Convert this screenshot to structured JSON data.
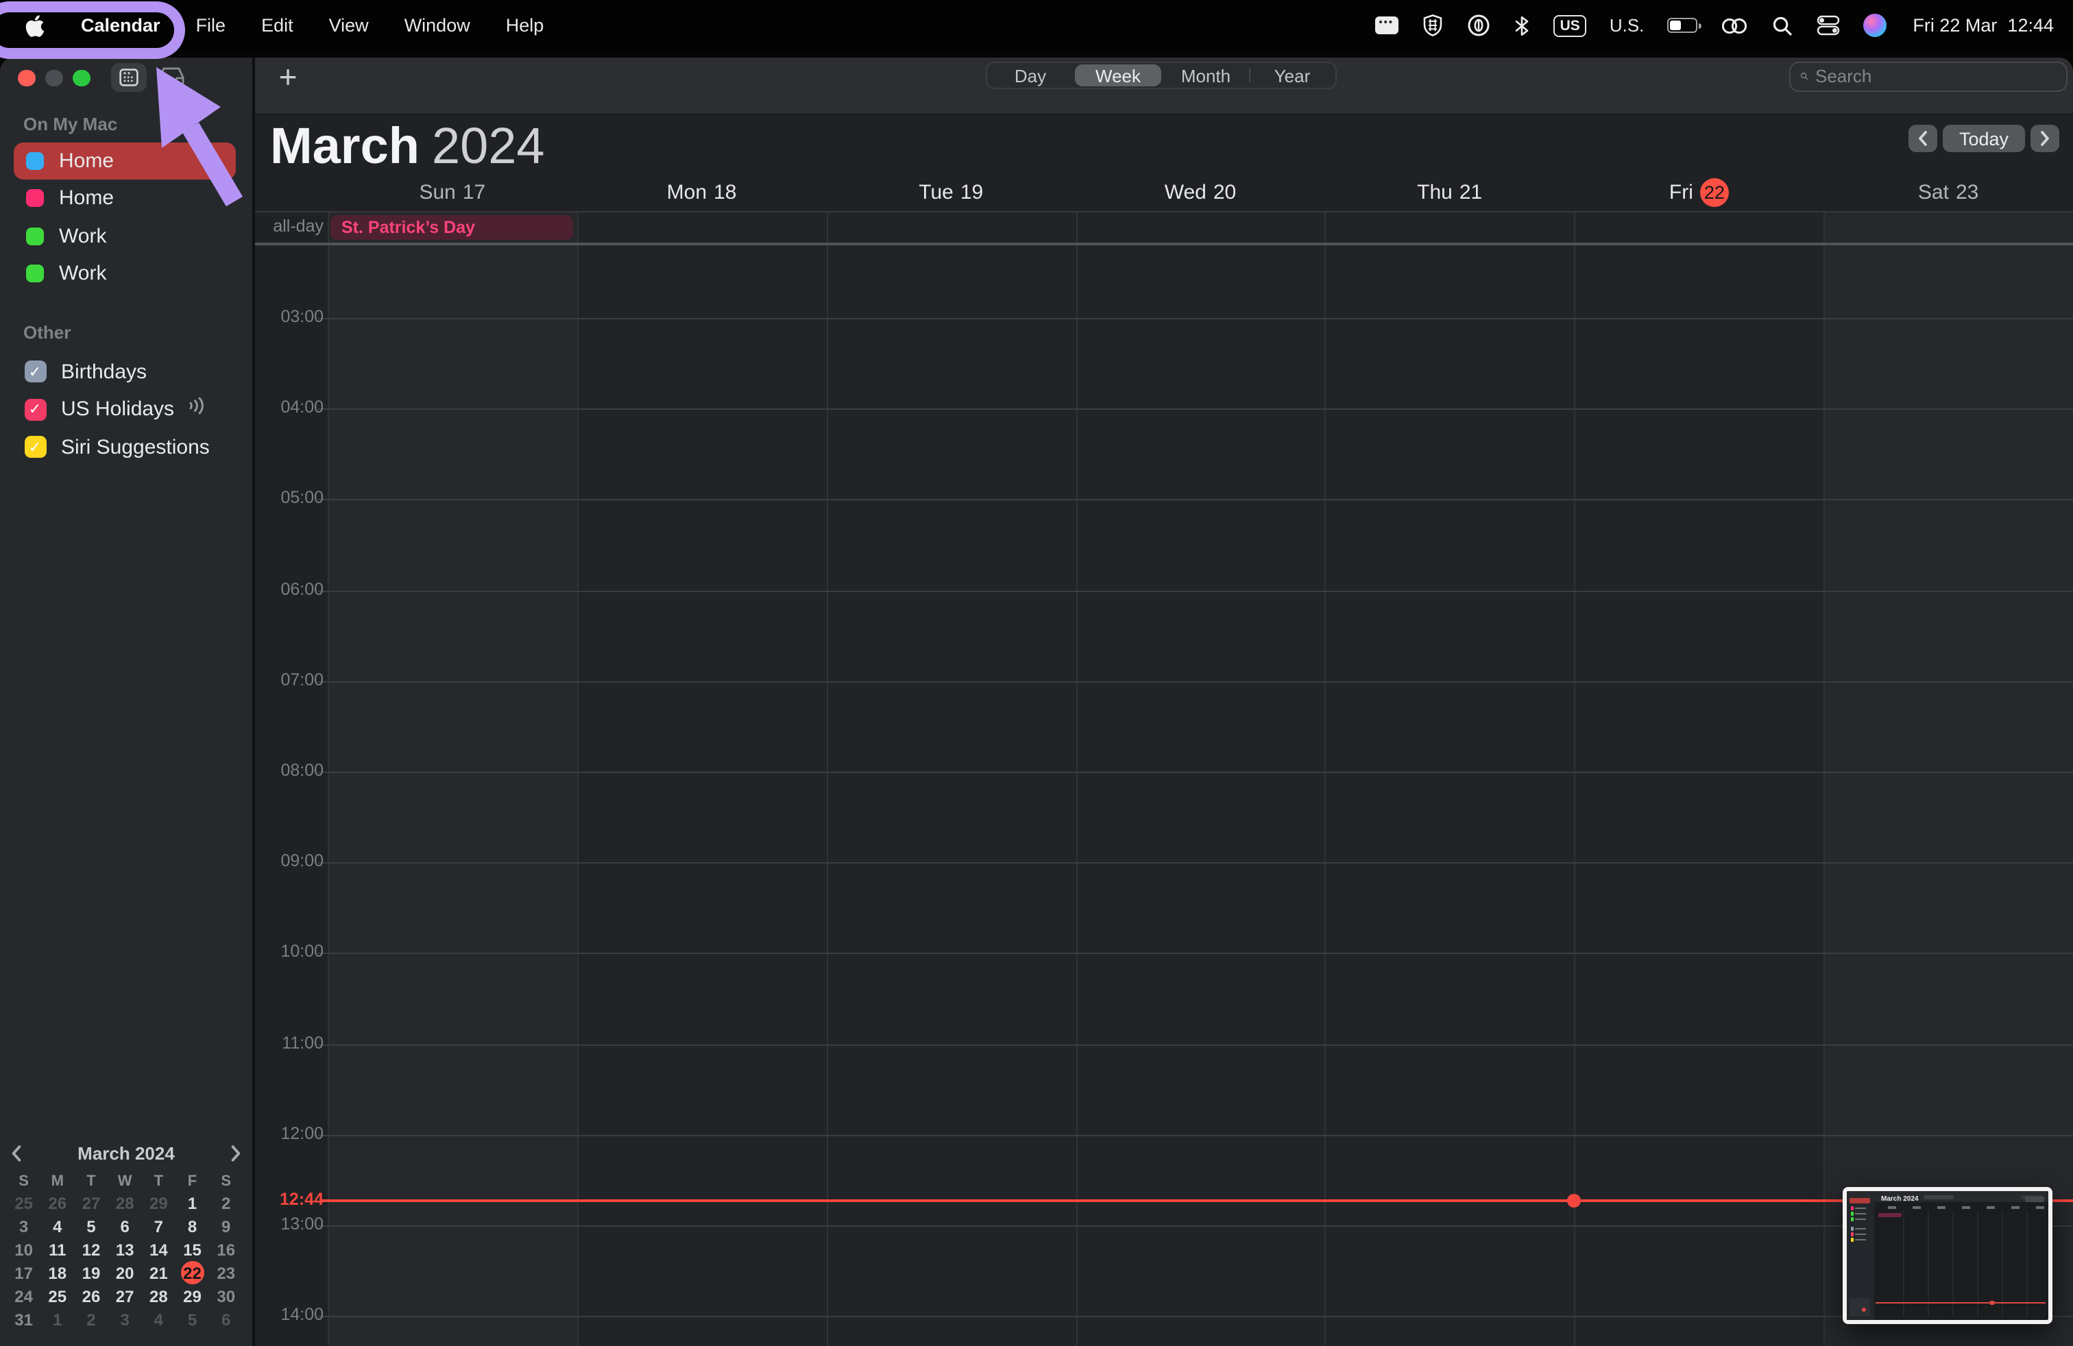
{
  "annotation": {
    "color": "#b493f4"
  },
  "menu_bar": {
    "app_menu": "Calendar",
    "menus": [
      "File",
      "Edit",
      "View",
      "Window",
      "Help"
    ],
    "status_icons": [
      "window-icon",
      "privacy-shield-icon",
      "power-circle-icon",
      "bluetooth-icon",
      "input-source-badge",
      "battery-icon",
      "linked-rings-icon",
      "spotlight-search-icon",
      "control-center-icon",
      "siri-icon"
    ],
    "input_source_short": "US",
    "input_source_label": "U.S.",
    "clock": "Fri 22 Mar  12:44"
  },
  "window_controls": {
    "close": "#ff5e57",
    "minimize": "#4b4e52",
    "zoom": "#2bc840"
  },
  "toolbar": {
    "add_label": "+",
    "views": [
      {
        "label": "Day",
        "selected": false
      },
      {
        "label": "Week",
        "selected": true
      },
      {
        "label": "Month",
        "selected": false
      },
      {
        "label": "Year",
        "selected": false
      }
    ],
    "search_placeholder": "Search"
  },
  "sidebar": {
    "sections": [
      {
        "title": "On My Mac",
        "items": [
          {
            "label": "Home",
            "color": "#35aef5",
            "selected": true
          },
          {
            "label": "Home",
            "color": "#fb2d71",
            "selected": false
          },
          {
            "label": "Work",
            "color": "#3ed93c",
            "selected": false
          },
          {
            "label": "Work",
            "color": "#3ed93c",
            "selected": false
          }
        ]
      },
      {
        "title": "Other",
        "items": [
          {
            "label": "Birthdays",
            "color": "#8f9bb0",
            "checked": true
          },
          {
            "label": "US Holidays",
            "color": "#f23b66",
            "checked": true,
            "subscribed": true
          },
          {
            "label": "Siri Suggestions",
            "color": "#fdd81c",
            "checked": true
          }
        ]
      }
    ],
    "mini_calendar": {
      "title": "March 2024",
      "day_letters": [
        "S",
        "M",
        "T",
        "W",
        "T",
        "F",
        "S"
      ],
      "weeks": [
        [
          {
            "d": "25",
            "t": "o"
          },
          {
            "d": "26",
            "t": "o"
          },
          {
            "d": "27",
            "t": "o"
          },
          {
            "d": "28",
            "t": "o"
          },
          {
            "d": "29",
            "t": "o"
          },
          {
            "d": "1",
            "t": "w"
          },
          {
            "d": "2",
            "t": "e"
          }
        ],
        [
          {
            "d": "3",
            "t": "e"
          },
          {
            "d": "4",
            "t": "w"
          },
          {
            "d": "5",
            "t": "w"
          },
          {
            "d": "6",
            "t": "w"
          },
          {
            "d": "7",
            "t": "w"
          },
          {
            "d": "8",
            "t": "w"
          },
          {
            "d": "9",
            "t": "e"
          }
        ],
        [
          {
            "d": "10",
            "t": "e"
          },
          {
            "d": "11",
            "t": "w"
          },
          {
            "d": "12",
            "t": "w"
          },
          {
            "d": "13",
            "t": "w"
          },
          {
            "d": "14",
            "t": "w"
          },
          {
            "d": "15",
            "t": "w"
          },
          {
            "d": "16",
            "t": "e"
          }
        ],
        [
          {
            "d": "17",
            "t": "e"
          },
          {
            "d": "18",
            "t": "w"
          },
          {
            "d": "19",
            "t": "w"
          },
          {
            "d": "20",
            "t": "w"
          },
          {
            "d": "21",
            "t": "w"
          },
          {
            "d": "22",
            "t": "today"
          },
          {
            "d": "23",
            "t": "e"
          }
        ],
        [
          {
            "d": "24",
            "t": "e"
          },
          {
            "d": "25",
            "t": "w"
          },
          {
            "d": "26",
            "t": "w"
          },
          {
            "d": "27",
            "t": "w"
          },
          {
            "d": "28",
            "t": "w"
          },
          {
            "d": "29",
            "t": "w"
          },
          {
            "d": "30",
            "t": "e"
          }
        ],
        [
          {
            "d": "31",
            "t": "e"
          },
          {
            "d": "1",
            "t": "o"
          },
          {
            "d": "2",
            "t": "o"
          },
          {
            "d": "3",
            "t": "o"
          },
          {
            "d": "4",
            "t": "o"
          },
          {
            "d": "5",
            "t": "o"
          },
          {
            "d": "6",
            "t": "o"
          }
        ]
      ]
    }
  },
  "calendar": {
    "month": "March",
    "year": "2024",
    "today_button": "Today",
    "all_day_label": "all-day",
    "days": [
      {
        "label": "Sun",
        "num": "17",
        "weekend": true,
        "today": false
      },
      {
        "label": "Mon",
        "num": "18",
        "weekend": false,
        "today": false
      },
      {
        "label": "Tue",
        "num": "19",
        "weekend": false,
        "today": false
      },
      {
        "label": "Wed",
        "num": "20",
        "weekend": false,
        "today": false
      },
      {
        "label": "Thu",
        "num": "21",
        "weekend": false,
        "today": false
      },
      {
        "label": "Fri",
        "num": "22",
        "weekend": false,
        "today": true
      },
      {
        "label": "Sat",
        "num": "23",
        "weekend": true,
        "today": false
      }
    ],
    "hours": [
      "03:00",
      "04:00",
      "05:00",
      "06:00",
      "07:00",
      "08:00",
      "09:00",
      "10:00",
      "11:00",
      "12:00",
      "13:00",
      "14:00"
    ],
    "current_time": "12:44",
    "accent_red": "#f5463d",
    "today_badge_color": "#fc4f44",
    "events": [
      {
        "title": "St. Patrick’s Day",
        "day_index": 0,
        "all_day": true,
        "text_color": "#fb447c",
        "bg": "#4e2130"
      }
    ]
  },
  "thumbnail": {
    "title": "March 2024"
  }
}
